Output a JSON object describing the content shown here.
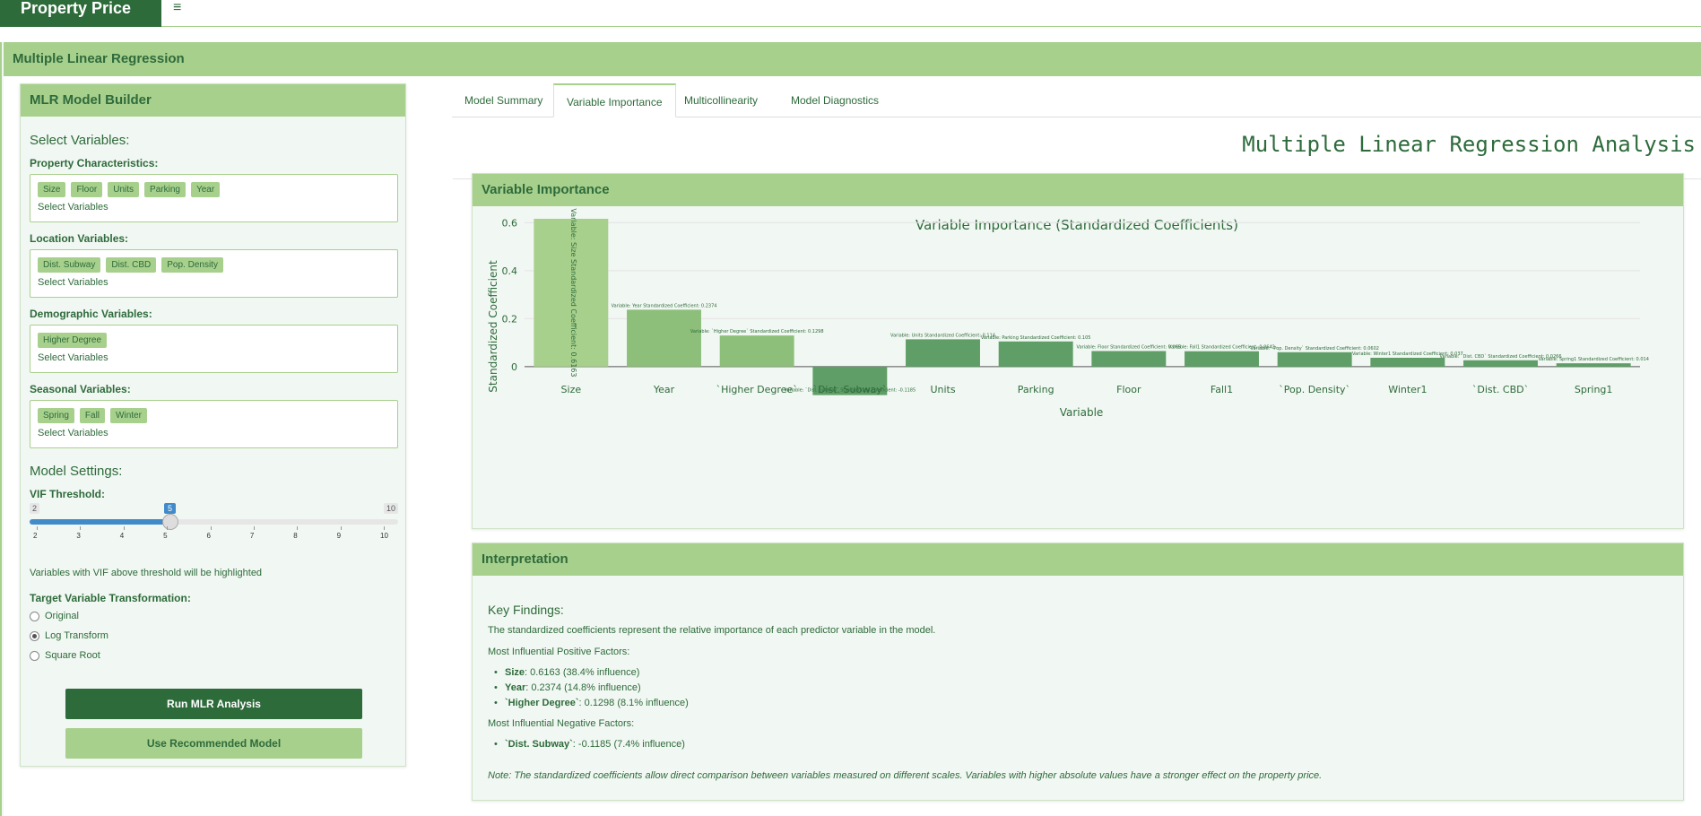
{
  "header": {
    "brand": "Property Price",
    "menu_icon": "hamburger-icon"
  },
  "page": {
    "title": "Multiple Linear Regression"
  },
  "sidebar": {
    "title": "MLR Model Builder",
    "select_variables_label": "Select Variables:",
    "groups": [
      {
        "label": "Property Characteristics:",
        "chips": [
          "Size",
          "Floor",
          "Units",
          "Parking",
          "Year"
        ],
        "placeholder": "Select Variables"
      },
      {
        "label": "Location Variables:",
        "chips": [
          "Dist. Subway",
          "Dist. CBD",
          "Pop. Density"
        ],
        "placeholder": "Select Variables"
      },
      {
        "label": "Demographic Variables:",
        "chips": [
          "Higher Degree"
        ],
        "placeholder": "Select Variables"
      },
      {
        "label": "Seasonal Variables:",
        "chips": [
          "Spring",
          "Fall",
          "Winter"
        ],
        "placeholder": "Select Variables"
      }
    ],
    "model_settings_label": "Model Settings:",
    "vif_label": "VIF Threshold:",
    "vif": {
      "min": "2",
      "max": "10",
      "value": "5",
      "ticks": [
        "2",
        "3",
        "4",
        "5",
        "6",
        "7",
        "8",
        "9",
        "10"
      ]
    },
    "vif_note": "Variables with VIF above threshold will be highlighted",
    "transform_label": "Target Variable Transformation:",
    "transform_options": [
      "Original",
      "Log Transform",
      "Square Root"
    ],
    "transform_selected": "Log Transform",
    "run_button": "Run MLR Analysis",
    "recommend_button": "Use Recommended Model"
  },
  "tabs": [
    "Model Summary",
    "Variable Importance",
    "Multicollinearity",
    "Model Diagnostics"
  ],
  "active_tab": "Variable Importance",
  "main_title": "Multiple Linear Regression Analysis",
  "importance_box": {
    "title": "Variable Importance"
  },
  "chart_data": {
    "type": "bar",
    "title": "Variable Importance (Standardized Coefficients)",
    "xlabel": "Variable",
    "ylabel": "Standardized Coefficient",
    "ylim": [
      -0.12,
      0.62
    ],
    "yticks": [
      "0",
      "0.2",
      "0.4",
      "0.6"
    ],
    "categories": [
      "Size",
      "Year",
      "`Higher Degree`",
      "`Dist. Subway`",
      "Units",
      "Parking",
      "Floor",
      "Fall1",
      "`Pop. Density`",
      "Winter1",
      "`Dist. CBD`",
      "Spring1"
    ],
    "values": [
      0.6163,
      0.2374,
      0.1298,
      -0.1185,
      0.114,
      0.105,
      0.065,
      0.0642,
      0.0602,
      0.037,
      0.0266,
      0.014
    ],
    "bar_labels": [
      "Variable: Size Standardized Coefficient: 0.6163",
      "Variable: Year Standardized Coefficient: 0.2374",
      "Variable: `Higher Degree` Standardized Coefficient: 0.1298",
      "Variable: `Dist. Subway` Standardized Coefficient: -0.1185",
      "Variable: Units Standardized Coefficient: 0.114",
      "Variable: Parking Standardized Coefficient: 0.105",
      "Variable: Floor Standardized Coefficient: 0.065",
      "Variable: Fall1 Standardized Coefficient: 0.0642",
      "Variable: `Pop. Density` Standardized Coefficient: 0.0602",
      "Variable: Winter1 Standardized Coefficient: 0.037",
      "Variable: `Dist. CBD` Standardized Coefficient: 0.0266",
      "Variable: Spring1 Standardized Coefficient: 0.014"
    ],
    "colors": {
      "positive_top": "#a8d08d",
      "positive": "#5f9f67",
      "negative": "#5f9f67",
      "text": "#2e6b3b"
    },
    "grid": true
  },
  "interpretation": {
    "title": "Interpretation",
    "heading": "Key Findings:",
    "intro": "The standardized coefficients represent the relative importance of each predictor variable in the model.",
    "positive_label": "Most Influential Positive Factors:",
    "positive_items": [
      {
        "name": "Size",
        "value": ": 0.6163 (38.4% influence)"
      },
      {
        "name": "Year",
        "value": ": 0.2374 (14.8% influence)"
      },
      {
        "name": "`Higher Degree`",
        "value": ": 0.1298 (8.1% influence)"
      }
    ],
    "negative_label": "Most Influential Negative Factors:",
    "negative_items": [
      {
        "name": "`Dist. Subway`",
        "value": ": -0.1185 (7.4% influence)"
      }
    ],
    "note": "Note: The standardized coefficients allow direct comparison between variables measured on different scales. Variables with higher absolute values have a stronger effect on the property price."
  }
}
